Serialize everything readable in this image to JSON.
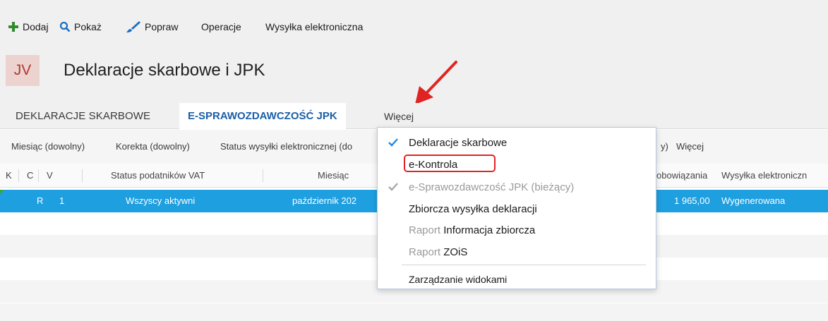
{
  "toolbar": {
    "add_label": "Dodaj",
    "show_label": "Pokaż",
    "edit_label": "Popraw",
    "operations_label": "Operacje",
    "e_send_label": "Wysyłka elektroniczna"
  },
  "header": {
    "badge": "JV",
    "title": "Deklaracje skarbowe i JPK"
  },
  "tabs": [
    {
      "label": "DEKLARACJE SKARBOWE"
    },
    {
      "label": "E-SPRAWOZDAWCZOŚĆ JPK"
    },
    {
      "label": "Więcej"
    }
  ],
  "filters": {
    "month": "Miesiąc (dowolny)",
    "correction": "Korekta (dowolny)",
    "e_status": "Status wysyłki elektronicznej (do",
    "tail": "y)",
    "more": "Więcej"
  },
  "grid": {
    "headers": {
      "k": "K",
      "c": "C",
      "v": "V",
      "vat_status": "Status podatników VAT",
      "month": "Miesiąc",
      "obligations": "obowiązania",
      "e_send": "Wysyłka elektroniczn"
    },
    "rows": [
      {
        "c": "R",
        "v": "1",
        "vat_status": "Wszyscy aktywni",
        "month": "październik 202",
        "obligations": "1 965,00",
        "e_send": "Wygenerowana"
      }
    ]
  },
  "dropdown": {
    "items": [
      {
        "label": "Deklaracje skarbowe",
        "checked": true
      },
      {
        "label": "e-Kontrola"
      },
      {
        "label": "e-Sprawozdawczość JPK",
        "suffix": "(bieżący)",
        "checked": true,
        "disabled": true
      },
      {
        "label": "Zbiorcza wysyłka deklaracji"
      },
      {
        "prefix": "Raport",
        "label": "Informacja zbiorcza"
      },
      {
        "prefix": "Raport",
        "label": "ZOiS"
      },
      {
        "label": "Zarządzanie widokami"
      }
    ]
  },
  "colors": {
    "accent_blue": "#1a5fa8",
    "selection": "#1e9fe0",
    "badge_bg": "#ecd3d0",
    "badge_text": "#b03a2e",
    "annotation": "#e02424"
  }
}
